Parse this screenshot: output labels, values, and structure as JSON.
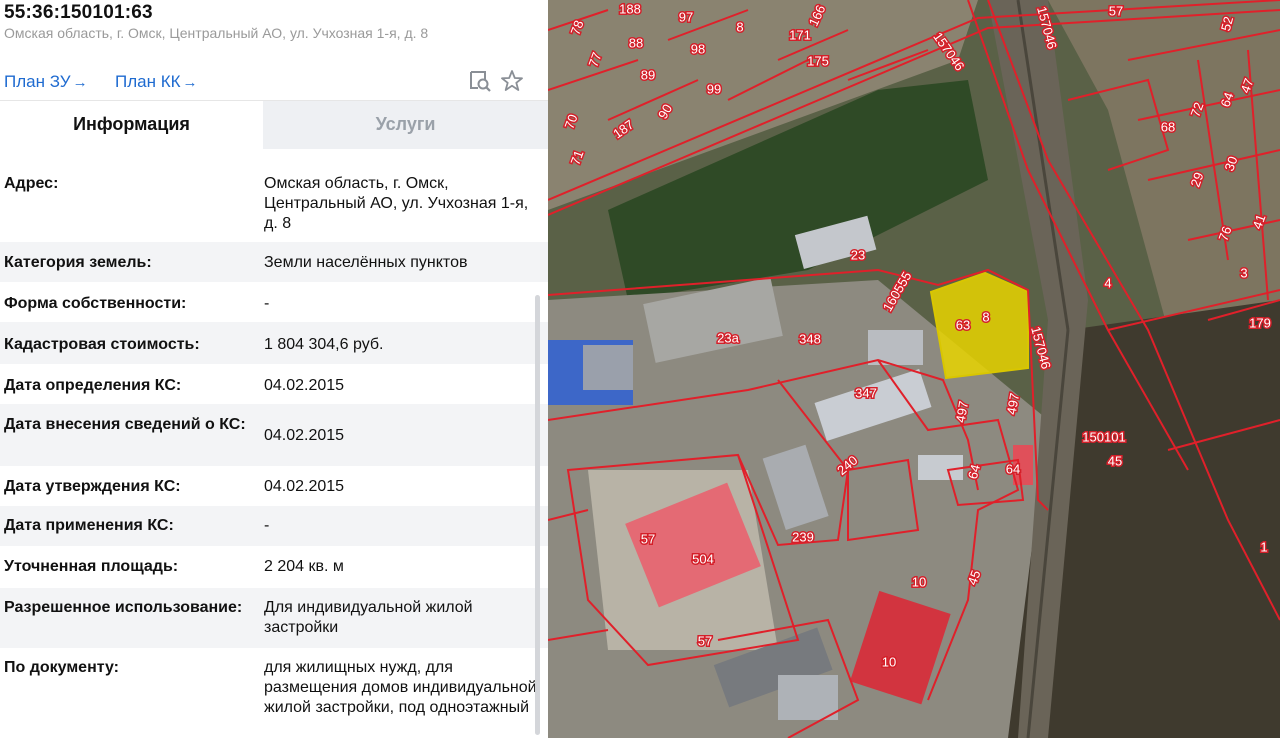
{
  "parcel": {
    "cadastral_number": "55:36:150101:63",
    "address_line": "Омская область, г. Омск, Центральный АО, ул. Учхозная 1-я, д. 8"
  },
  "links": {
    "plan_zu": "План ЗУ",
    "plan_kk": "План КК",
    "arrow": "→"
  },
  "icons": {
    "search": "search-map-icon",
    "favorite": "star-icon"
  },
  "tabs": {
    "info": "Информация",
    "services": "Услуги"
  },
  "info_rows": [
    {
      "key": "Адрес:",
      "value": "Омская область, г. Омск, Центральный АО, ул. Учхозная 1-я, д. 8"
    },
    {
      "key": "Категория земель:",
      "value": "Земли населённых пунктов"
    },
    {
      "key": "Форма собственности:",
      "value": "-"
    },
    {
      "key": "Кадастровая стоимость:",
      "value": "1 804 304,6 руб."
    },
    {
      "key": "Дата определения КС:",
      "value": "04.02.2015"
    },
    {
      "key": "Дата внесения сведений о КС:",
      "value": "04.02.2015"
    },
    {
      "key": "Дата утверждения КС:",
      "value": "04.02.2015"
    },
    {
      "key": "Дата применения КС:",
      "value": "-"
    },
    {
      "key": "Уточненная площадь:",
      "value": "2 204 кв. м"
    },
    {
      "key": "Разрешенное использование:",
      "value": "Для индивидуальной жилой застройки"
    },
    {
      "key": "По документу:",
      "value": "для жилищных нужд, для размещения домов индивидуальной жилой застройки, под одноэтажный"
    }
  ],
  "map": {
    "labels": [
      "188",
      "97",
      "8",
      "166",
      "57",
      "157046",
      "52",
      "78",
      "77",
      "88",
      "98",
      "171",
      "175",
      "89",
      "99",
      "70",
      "71",
      "187",
      "90",
      "157046",
      "68",
      "72",
      "64",
      "47",
      "29",
      "30",
      "76",
      "41",
      "3",
      "179",
      "23",
      "160555",
      "348",
      "347",
      "63",
      "8",
      "157046",
      "497",
      "497",
      "150101",
      "45",
      "240",
      "64",
      "64",
      "239",
      "57",
      "57",
      "10",
      "45",
      "10",
      "4",
      "1",
      "23a",
      "504"
    ],
    "highlight_color": "#e8d300",
    "boundary_color": "#e0202a"
  }
}
